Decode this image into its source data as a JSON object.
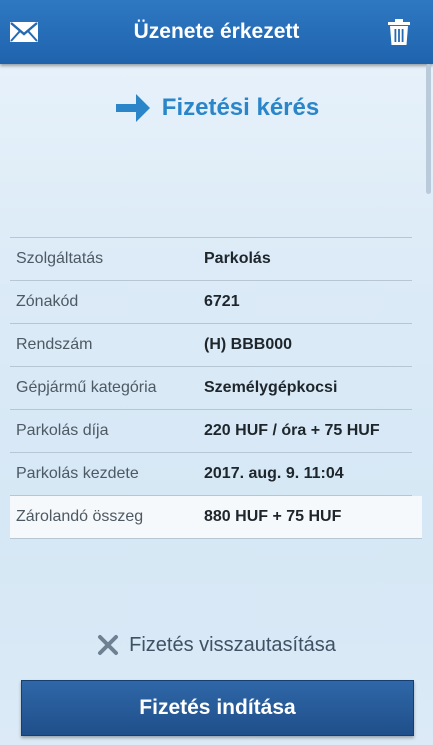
{
  "header": {
    "title": "Üzenete érkezett",
    "left_icon": "envelope-icon",
    "right_icon": "trash-icon"
  },
  "heading": {
    "icon": "arrow-right-icon",
    "text": "Fizetési kérés",
    "color": "#2a86c9"
  },
  "details": [
    {
      "label": "Szolgáltatás",
      "value": "Parkolás"
    },
    {
      "label": "Zónakód",
      "value": "6721"
    },
    {
      "label": "Rendszám",
      "value": "(H) BBB000"
    },
    {
      "label": "Gépjármű kategória",
      "value": "Személygépkocsi"
    },
    {
      "label": "Parkolás díja",
      "value": "220 HUF / óra + 75 HUF"
    },
    {
      "label": "Parkolás kezdete",
      "value": "2017. aug. 9. 11:04"
    },
    {
      "label": "Zárolandó összeg",
      "value": "880 HUF + 75 HUF"
    }
  ],
  "actions": {
    "reject_icon": "close-icon",
    "reject_label": "Fizetés visszautasítása",
    "start_label": "Fizetés indítása"
  },
  "colors": {
    "header": "#1f63ad",
    "primary_button": "#2f67a8",
    "background": "#dcebf7"
  }
}
